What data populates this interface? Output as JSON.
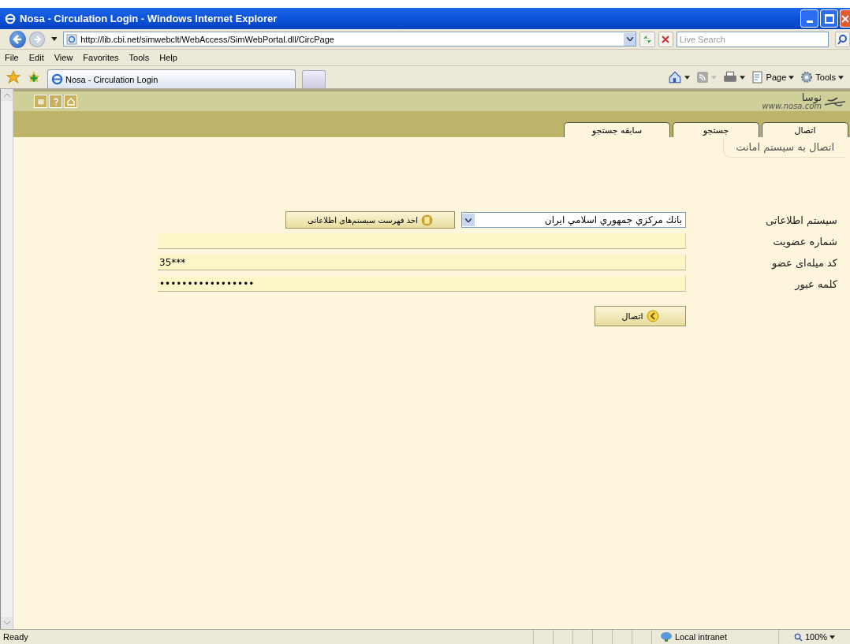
{
  "window": {
    "title": "Nosa - Circulation Login - Windows Internet Explorer"
  },
  "address_bar": {
    "url": "http://lib.cbi.net/simwebclt/WebAccess/SimWebPortal.dll/CircPage"
  },
  "search": {
    "placeholder": "Live Search"
  },
  "menu": {
    "file": "File",
    "edit": "Edit",
    "view": "View",
    "favorites": "Favorites",
    "tools": "Tools",
    "help": "Help"
  },
  "browser_tabs": [
    {
      "label": "Nosa - Circulation Login"
    }
  ],
  "command_bar": {
    "buttons": [
      {
        "kind": "home"
      },
      {
        "kind": "feed"
      },
      {
        "kind": "print"
      }
    ],
    "page_menu": "Page",
    "tools_menu": "Tools"
  },
  "site": {
    "logo": "نوسا",
    "logo_url": "www.nosa.com"
  },
  "site_tabs": [
    {
      "label": "اتصال"
    },
    {
      "label": "جستجو"
    },
    {
      "label": "سابقه جستجو"
    }
  ],
  "page_title": "اتصال به سیستم امانت",
  "form": {
    "rows": [
      {
        "kind": "select",
        "label": "سیستم اطلاعاتی",
        "value": "بانك مركزي جمهوري اسلامي ايران",
        "button": "اخذ فهرست سیستم‌های اطلاعاتی"
      },
      {
        "kind": "text",
        "label": "شماره عضویت"
      },
      {
        "kind": "text",
        "label": "کد میله‌ای عضو",
        "value": "35***"
      },
      {
        "kind": "text",
        "label": "کلمه عبور",
        "value": "•••••••••••••••••"
      }
    ],
    "submit": "اتصال"
  },
  "status_bar": {
    "text": "Ready",
    "zone": "Local intranet",
    "zoom": "100%"
  }
}
